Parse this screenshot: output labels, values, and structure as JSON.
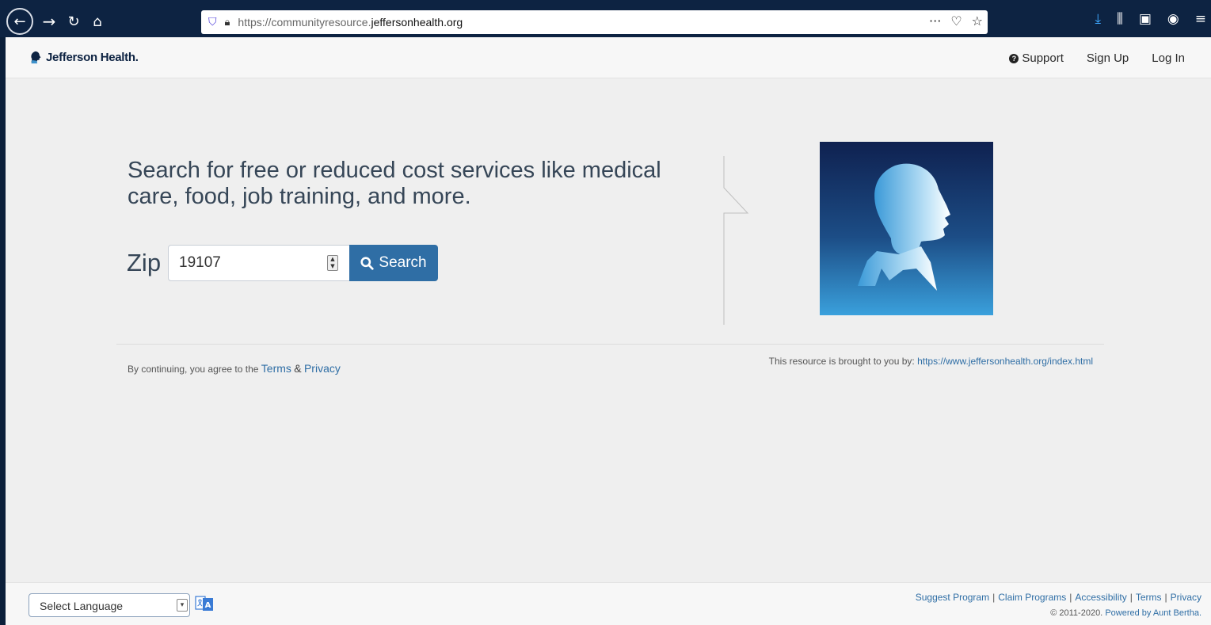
{
  "browser": {
    "url_prefix": "https://communityresource.",
    "url_domain": "jeffersonhealth.org",
    "icons": [
      "back-icon",
      "forward-icon",
      "reload-icon",
      "home-icon",
      "shield-icon",
      "lock-icon",
      "more-icon",
      "pocket-icon",
      "bookmark-star-icon",
      "download-icon",
      "library-icon",
      "sidebar-icon",
      "account-icon",
      "menu-icon"
    ]
  },
  "header": {
    "logo_text": "Jefferson Health.",
    "nav": {
      "support": "Support",
      "signup": "Sign Up",
      "login": "Log In"
    }
  },
  "main": {
    "headline": "Search for free or reduced cost services like medical care, food, job training, and more.",
    "zip_label": "Zip",
    "zip_value": "19107",
    "search_label": "Search",
    "agree_prefix": "By continuing, you agree to the",
    "terms_link": "Terms",
    "amp": "&",
    "privacy_link": "Privacy",
    "brought_prefix": "This resource is brought to you by:",
    "brought_link": "https://www.jeffersonhealth.org/index.html"
  },
  "footer": {
    "language_select": "Select Language",
    "links": [
      "Suggest Program",
      "Claim Programs",
      "Accessibility",
      "Terms",
      "Privacy"
    ],
    "separator": "|",
    "copyright_prefix": "© 2011-2020.",
    "powered_by": "Powered by Aunt Bertha."
  },
  "colors": {
    "brand_navy": "#0d2342",
    "button_blue": "#2f6ea5",
    "page_bg": "#efefef"
  }
}
